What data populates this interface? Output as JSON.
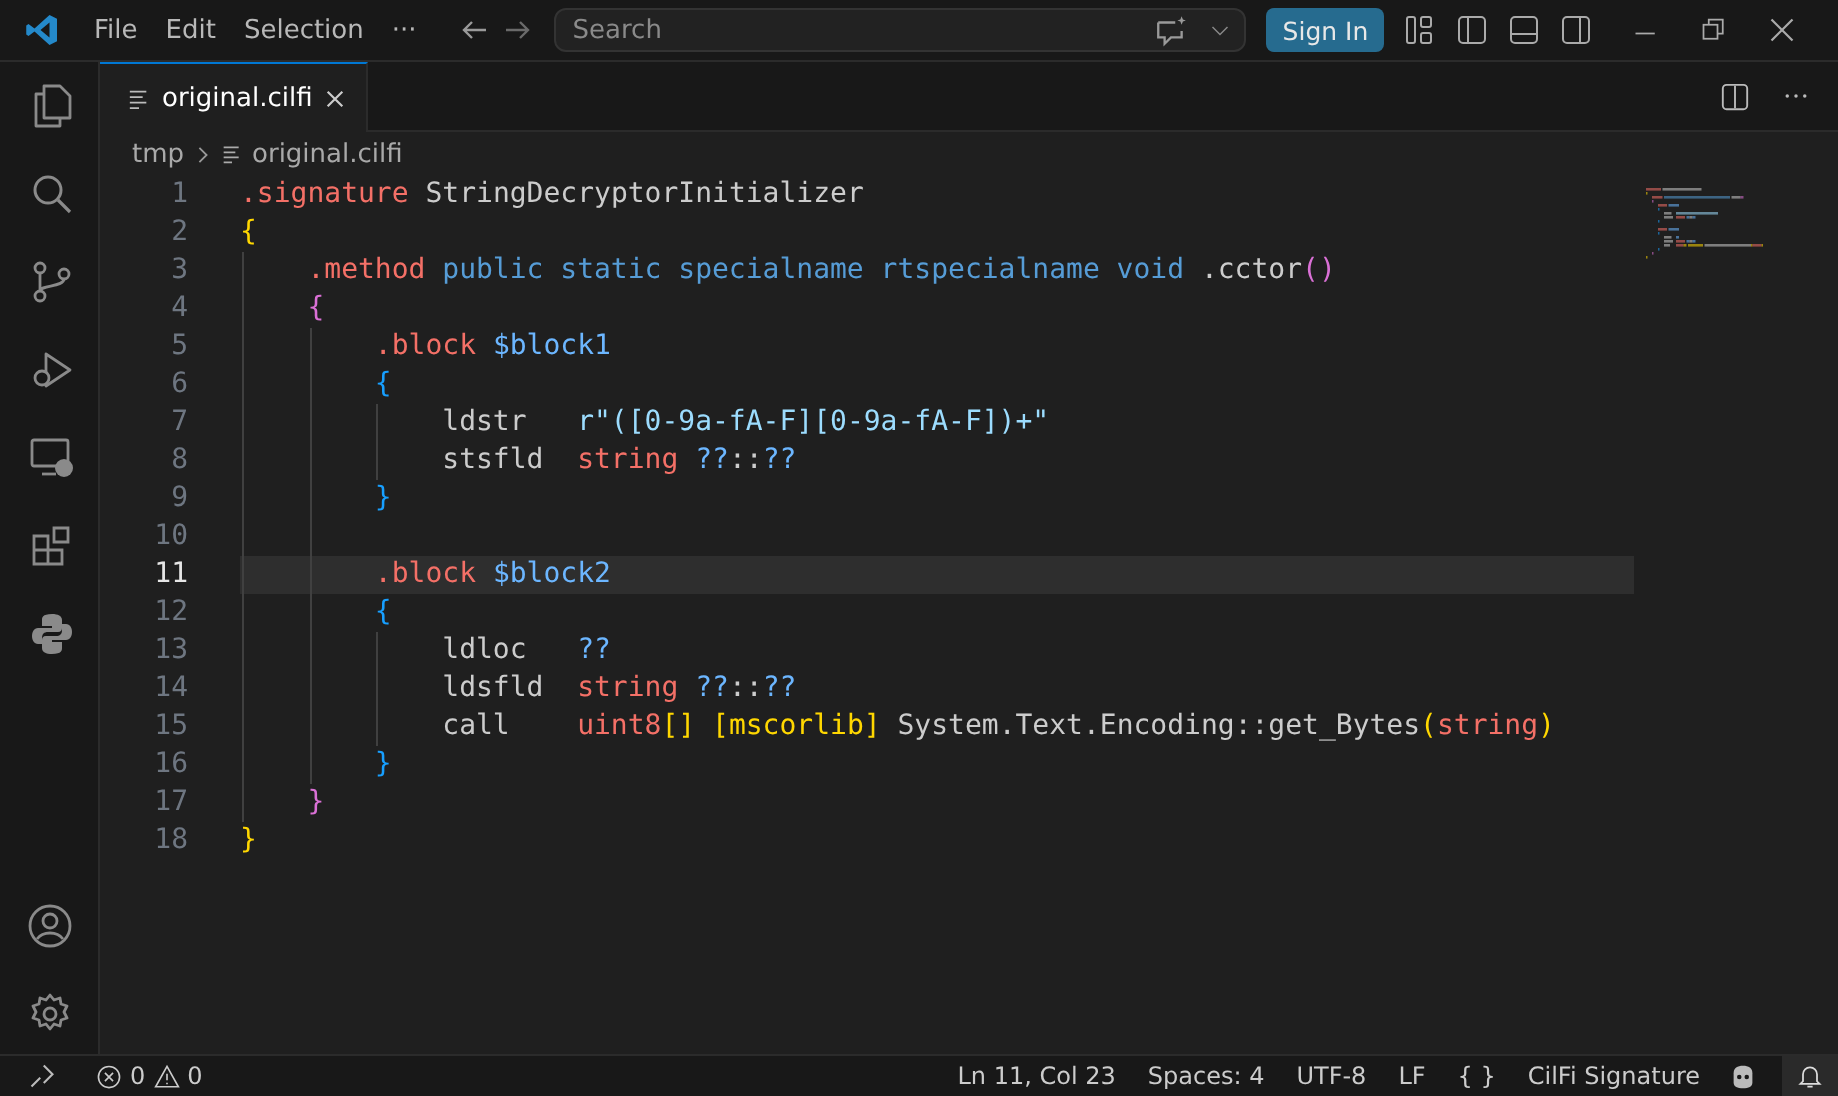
{
  "title_bar": {
    "menu": [
      "File",
      "Edit",
      "Selection",
      "···"
    ],
    "search": {
      "placeholder": "Search"
    },
    "sign_in": "Sign In"
  },
  "activity_bar": {
    "items": [
      {
        "kind": "files",
        "selected": false
      },
      {
        "kind": "search",
        "selected": false
      },
      {
        "kind": "source-control",
        "selected": false
      },
      {
        "kind": "run",
        "selected": false
      },
      {
        "kind": "remote",
        "selected": false
      },
      {
        "kind": "extensions",
        "selected": false
      },
      {
        "kind": "python",
        "selected": false
      }
    ],
    "bottom": [
      {
        "kind": "account"
      },
      {
        "kind": "settings"
      }
    ]
  },
  "tabs": [
    {
      "label": "original.cilfi",
      "selected": true
    }
  ],
  "breadcrumb": [
    "tmp",
    "original.cilfi"
  ],
  "editor": {
    "lines": [
      {
        "number": "1",
        "current": false,
        "tokens": [
          {
            "text": ".signature",
            "kind": "directive"
          },
          {
            "text": " StringDecryptorInitializer",
            "kind": "plain"
          }
        ]
      },
      {
        "number": "2",
        "current": false,
        "tokens": [
          {
            "text": "{",
            "kind": "brace1"
          }
        ]
      },
      {
        "number": "3",
        "current": false,
        "tokens": [
          {
            "text": "    .method",
            "kind": "directive"
          },
          {
            "text": " public static specialname rtspecialname void",
            "kind": "modifier"
          },
          {
            "text": " .cctor",
            "kind": "plain"
          },
          {
            "text": "()",
            "kind": "brace2"
          }
        ]
      },
      {
        "number": "4",
        "current": false,
        "tokens": [
          {
            "text": "    {",
            "kind": "brace2"
          }
        ]
      },
      {
        "number": "5",
        "current": false,
        "tokens": [
          {
            "text": "        .block",
            "kind": "directive"
          },
          {
            "text": " $block1",
            "kind": "variable"
          }
        ]
      },
      {
        "number": "6",
        "current": false,
        "tokens": [
          {
            "text": "        {",
            "kind": "brace3"
          }
        ]
      },
      {
        "number": "7",
        "current": false,
        "tokens": [
          {
            "text": "            ldstr   ",
            "kind": "plain"
          },
          {
            "text": "r\"([0-9a-fA-F][0-9a-fA-F])+\"",
            "kind": "string"
          }
        ]
      },
      {
        "number": "8",
        "current": false,
        "tokens": [
          {
            "text": "            stsfld  ",
            "kind": "plain"
          },
          {
            "text": "string",
            "kind": "type"
          },
          {
            "text": " ??",
            "kind": "variable"
          },
          {
            "text": "::",
            "kind": "plain"
          },
          {
            "text": "??",
            "kind": "variable"
          }
        ]
      },
      {
        "number": "9",
        "current": false,
        "tokens": [
          {
            "text": "        }",
            "kind": "brace3"
          }
        ]
      },
      {
        "number": "10",
        "current": false
      },
      {
        "number": "11",
        "current": true,
        "tokens": [
          {
            "text": "        .block",
            "kind": "directive"
          },
          {
            "text": " $block2",
            "kind": "variable"
          }
        ]
      },
      {
        "number": "12",
        "current": false,
        "tokens": [
          {
            "text": "        {",
            "kind": "brace3"
          }
        ]
      },
      {
        "number": "13",
        "current": false,
        "tokens": [
          {
            "text": "            ldloc   ",
            "kind": "plain"
          },
          {
            "text": "??",
            "kind": "variable"
          }
        ]
      },
      {
        "number": "14",
        "current": false,
        "tokens": [
          {
            "text": "            ldsfld  ",
            "kind": "plain"
          },
          {
            "text": "string",
            "kind": "type"
          },
          {
            "text": " ??",
            "kind": "variable"
          },
          {
            "text": "::",
            "kind": "plain"
          },
          {
            "text": "??",
            "kind": "variable"
          }
        ]
      },
      {
        "number": "15",
        "current": false,
        "tokens": [
          {
            "text": "            call    ",
            "kind": "plain"
          },
          {
            "text": "uint8",
            "kind": "type"
          },
          {
            "text": "[]",
            "kind": "brace1"
          },
          {
            "text": " [mscorlib]",
            "kind": "brace1"
          },
          {
            "text": " System.Text.Encoding::get_Bytes",
            "kind": "plain"
          },
          {
            "text": "(",
            "kind": "brace1"
          },
          {
            "text": "string",
            "kind": "type"
          },
          {
            "text": ")",
            "kind": "brace1"
          }
        ]
      },
      {
        "number": "16",
        "current": false,
        "tokens": [
          {
            "text": "        }",
            "kind": "brace3"
          }
        ]
      },
      {
        "number": "17",
        "current": false,
        "tokens": [
          {
            "text": "    }",
            "kind": "brace2"
          }
        ]
      },
      {
        "number": "18",
        "current": false,
        "tokens": [
          {
            "text": "}",
            "kind": "brace1"
          }
        ]
      }
    ]
  },
  "status_bar": {
    "errors": "0",
    "warnings": "0",
    "items": [
      "Ln 11, Col 23",
      "Spaces: 4",
      "UTF-8",
      "LF"
    ],
    "language_icon": "{ }",
    "language": "CilFi Signature"
  }
}
